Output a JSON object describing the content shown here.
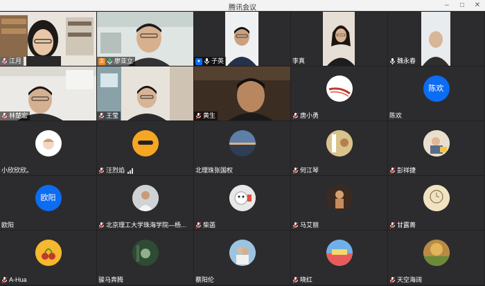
{
  "window": {
    "title": "腾讯会议"
  },
  "participants": [
    {
      "name": "江月"
    },
    {
      "name": "廖亚立"
    },
    {
      "name": "子英"
    },
    {
      "name": "李真"
    },
    {
      "name": "魏永春"
    },
    {
      "name": "林楚宏"
    },
    {
      "name": "王莹"
    },
    {
      "name": "黄生"
    },
    {
      "name": "唐小勇"
    },
    {
      "name": "陈欢",
      "avatar_text": "陈欢"
    },
    {
      "name": "小欣欣欣。"
    },
    {
      "name": "汪烈焰"
    },
    {
      "name": "北理珠张国权"
    },
    {
      "name": "何江琴"
    },
    {
      "name": "彭祥捷"
    },
    {
      "name": "欧阳",
      "avatar_text": "欧阳"
    },
    {
      "name": "北京理工大学珠海学院—杨..."
    },
    {
      "name": "柴菡"
    },
    {
      "name": "马艾丽"
    },
    {
      "name": "甘露菁"
    },
    {
      "name": "A-Hua"
    },
    {
      "name": "骏马奔腾"
    },
    {
      "name": "蔡阳伦"
    },
    {
      "name": "晓红"
    },
    {
      "name": "天空海阔"
    }
  ],
  "colors": {
    "accent_blue": "#0c6cf2",
    "active_border": "#2bc35a",
    "host_orange": "#f08a24"
  }
}
